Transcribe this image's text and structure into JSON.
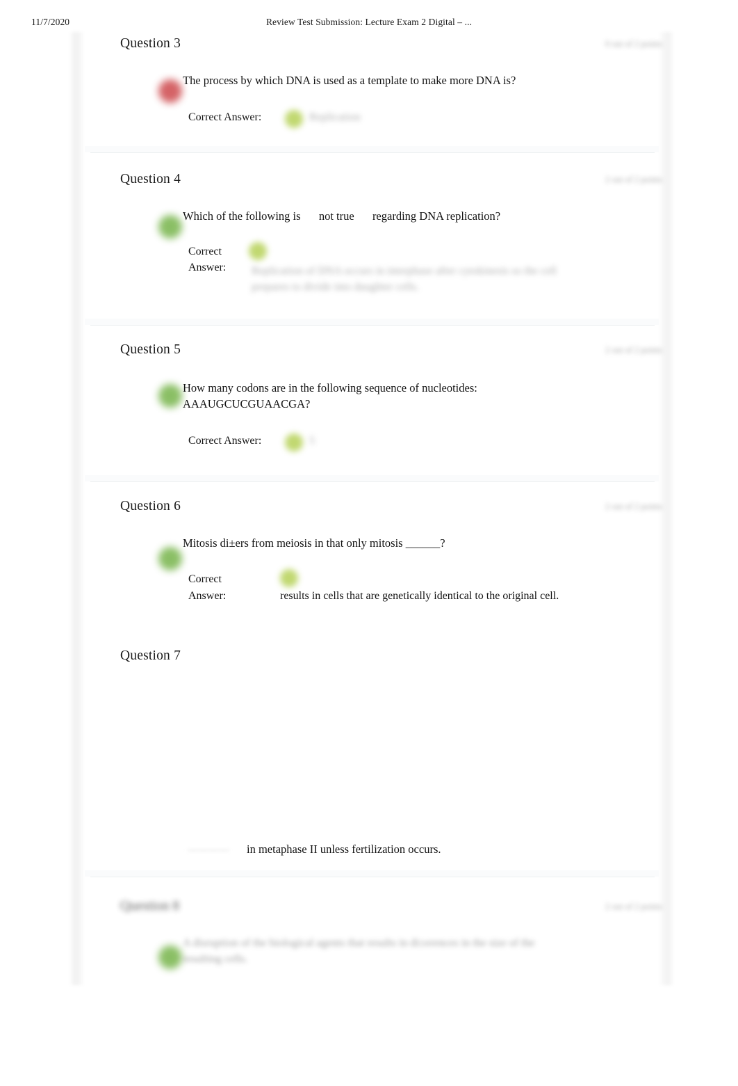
{
  "header": {
    "date": "11/7/2020",
    "title": "Review Test Submission: Lecture Exam 2 Digital – ..."
  },
  "labels": {
    "correct_answer": "Correct Answer:",
    "correct_word": "Correct",
    "answer_word": "Answer:",
    "points_redacted": "2 out of 2 points"
  },
  "questions": [
    {
      "id": "q3",
      "title": "Question 3",
      "status": "incorrect",
      "points": "0 out of 2 points",
      "text": "The process by which DNA is used as a template to make more DNA is?",
      "answer_label": "Correct Answer:",
      "answer_value": "Replication",
      "answer_redacted": true
    },
    {
      "id": "q4",
      "title": "Question 4",
      "status": "correct",
      "points": "2 out of 2 points",
      "text_parts": {
        "before": "Which of the following is",
        "emphasis": "not true",
        "after": "regarding DNA replication?"
      },
      "answer_label_line1": "Correct",
      "answer_label_line2": "Answer:",
      "answer_value_line1": "Replication of DNA occurs in interphase after cytokinesis so the cell",
      "answer_value_line2": "prepares to divide into daughter cells.",
      "answer_redacted": true
    },
    {
      "id": "q5",
      "title": "Question 5",
      "status": "correct",
      "points": "2 out of 2 points",
      "text_line1": "How many codons are in the following sequence of nucleotides:",
      "text_line2": "AAAUGCUCGUAACGA?",
      "answer_label": "Correct Answer:",
      "answer_value": "5",
      "answer_redacted": true
    },
    {
      "id": "q6",
      "title": "Question 6",
      "status": "correct",
      "points": "2 out of 2 points",
      "text": "Mitosis di±ers from meiosis in that only mitosis ______?",
      "answer_label_line1": "Correct",
      "answer_label_line2": "Answer:",
      "answer_value": "results in cells that are genetically identical to the original cell.",
      "answer_redacted": false
    },
    {
      "id": "q7",
      "title": "Question 7",
      "status": "none",
      "points": "",
      "trailing_text": "in metaphase II unless fertilization occurs."
    },
    {
      "id": "q8",
      "title": "Question 8",
      "status": "correct",
      "points": "2 out of 2 points",
      "text_line1": "A disruption of the biological agents that results in di±erences in the size of the",
      "text_line2": "resulting cells.",
      "title_redacted": true,
      "text_redacted": true
    }
  ],
  "colors": {
    "correct_marker": "#6aad3a",
    "incorrect_marker": "#c9383c",
    "answer_marker": "#a9c93a",
    "text": "#141414",
    "divider": "#eceff1",
    "page_background": "#ffffff"
  }
}
